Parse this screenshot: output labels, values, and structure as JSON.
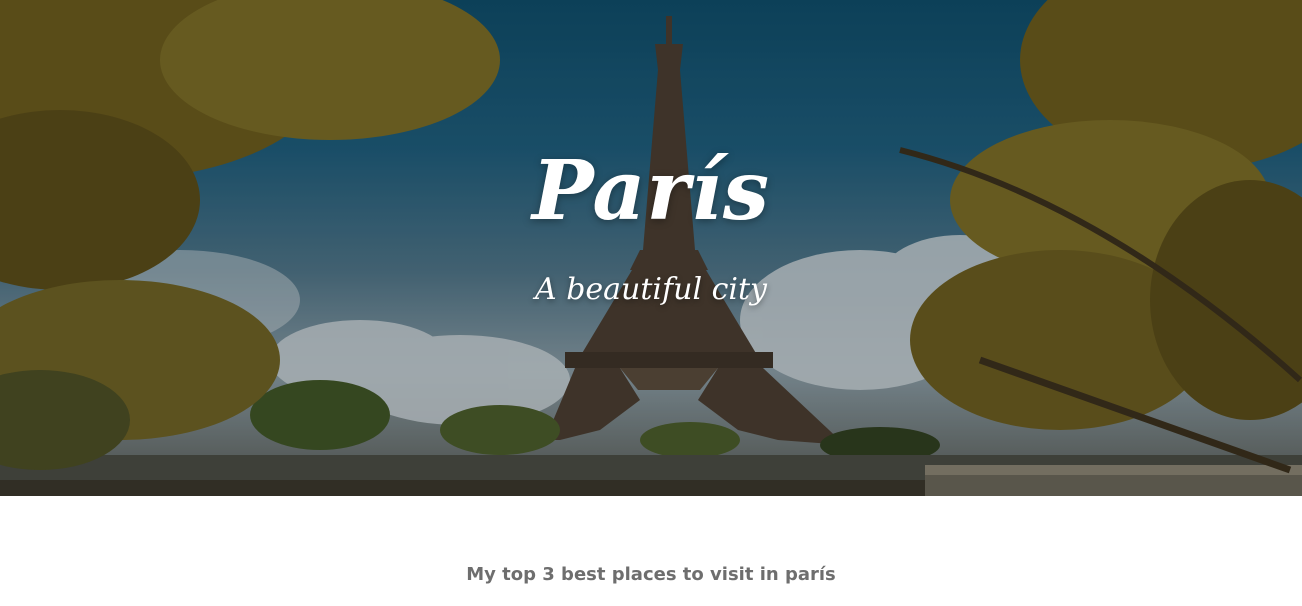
{
  "hero": {
    "title": "París",
    "subtitle": "A beautiful city",
    "image": "eiffel-tower-photo"
  },
  "section": {
    "heading": "My top 3 best places to visit in parís"
  },
  "colors": {
    "sky_top": "#0d4a66",
    "heading_text": "#6e6e6e",
    "hero_text": "#ffffff"
  }
}
